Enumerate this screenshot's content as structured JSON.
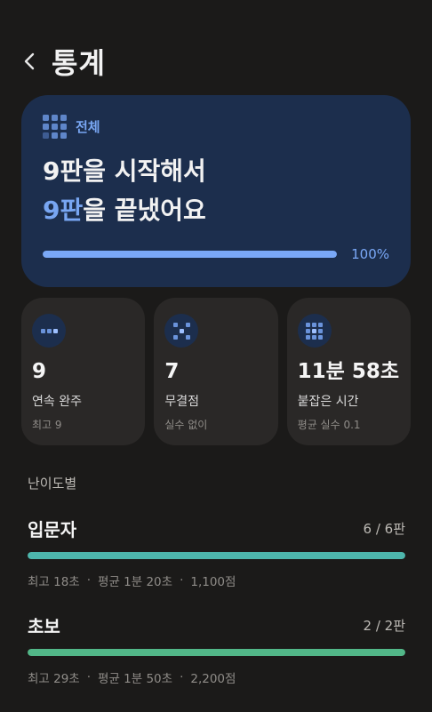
{
  "header": {
    "title": "통계",
    "back_icon": "chevron-left-icon"
  },
  "overview": {
    "tag": "전체",
    "line1": "9판을 시작해서",
    "line2_accent": "9판",
    "line2_rest": "을 끝냈어요",
    "progress": 1.0,
    "progress_label": "100%",
    "accent_color": "#78a6f2"
  },
  "stats": [
    {
      "icon": "streak-dots-icon",
      "value": "9",
      "label": "연속 완주",
      "sub": "최고 9"
    },
    {
      "icon": "flawless-dots-icon",
      "value": "7",
      "label": "무결점",
      "sub": "실수 없이"
    },
    {
      "icon": "time-grid-icon",
      "value": "11분 58초",
      "label": "붙잡은 시간",
      "sub": "평균 실수 0.1"
    }
  ],
  "difficulty": {
    "section_title": "난이도별",
    "items": [
      {
        "name": "입문자",
        "count": "6 / 6판",
        "progress": 1.0,
        "color": "#4db6ac",
        "best": "최고 18초",
        "avg": "평균 1분 20초",
        "score": "1,100점"
      },
      {
        "name": "초보",
        "count": "2 / 2판",
        "progress": 1.0,
        "color": "#52b788",
        "best": "최고 29초",
        "avg": "평균 1분 50초",
        "score": "2,200점"
      }
    ]
  }
}
